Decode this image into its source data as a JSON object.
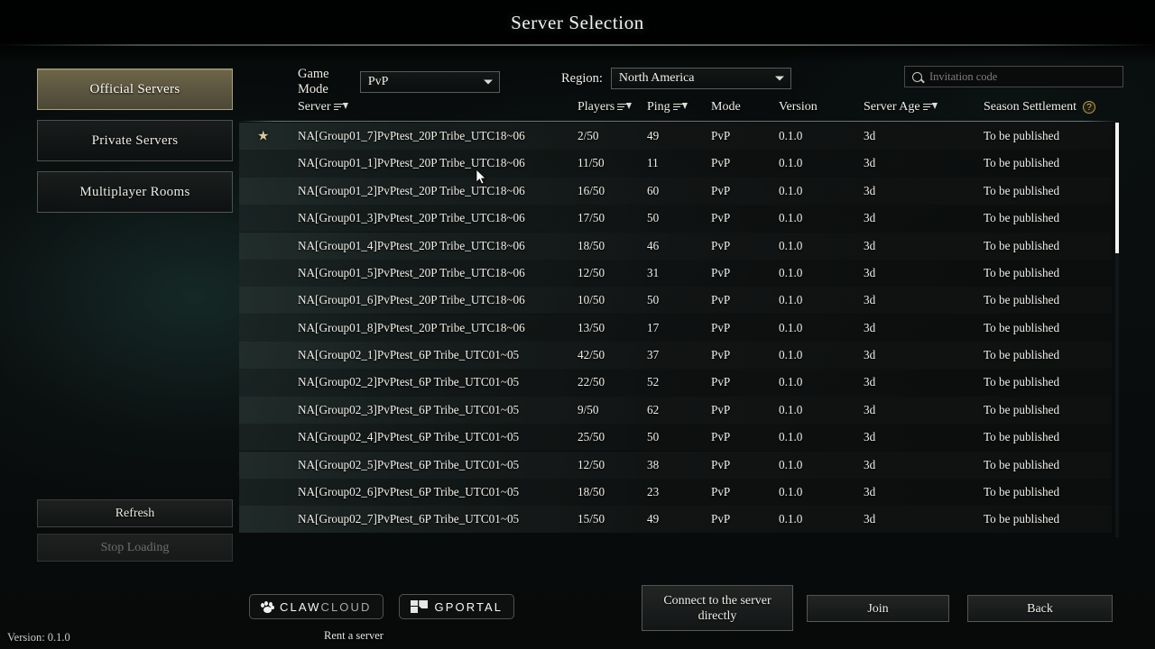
{
  "window": {
    "title": "Server Selection",
    "version_label": "Version: 0.1.0"
  },
  "sidebar": {
    "nav_items": [
      {
        "label": "Official Servers",
        "active": true
      },
      {
        "label": "Private Servers",
        "active": false
      },
      {
        "label": "Multiplayer Rooms",
        "active": false
      }
    ],
    "refresh_label": "Refresh",
    "stop_loading_label": "Stop Loading"
  },
  "filters": {
    "game_mode_label": "Game Mode",
    "game_mode_value": "PvP",
    "region_label": "Region:",
    "region_value": "North America"
  },
  "search": {
    "placeholder": "Invitation code",
    "value": ""
  },
  "table": {
    "columns": [
      {
        "key": "name",
        "label": "Server",
        "sortable": true
      },
      {
        "key": "players",
        "label": "Players",
        "sortable": true
      },
      {
        "key": "ping",
        "label": "Ping",
        "sortable": true
      },
      {
        "key": "mode",
        "label": "Mode",
        "sortable": false
      },
      {
        "key": "version",
        "label": "Version",
        "sortable": false
      },
      {
        "key": "age",
        "label": "Server Age",
        "sortable": true
      },
      {
        "key": "season",
        "label": "Season Settlement",
        "sortable": false,
        "help": true
      }
    ],
    "rows": [
      {
        "favorite": true,
        "name": "NA[Group01_7]PvPtest_20P Tribe_UTC18~06",
        "players": "2/50",
        "ping": "49",
        "mode": "PvP",
        "version": "0.1.0",
        "age": "3d",
        "season": "To be published"
      },
      {
        "favorite": false,
        "name": "NA[Group01_1]PvPtest_20P Tribe_UTC18~06",
        "players": "11/50",
        "ping": "11",
        "mode": "PvP",
        "version": "0.1.0",
        "age": "3d",
        "season": "To be published"
      },
      {
        "favorite": false,
        "name": "NA[Group01_2]PvPtest_20P Tribe_UTC18~06",
        "players": "16/50",
        "ping": "60",
        "mode": "PvP",
        "version": "0.1.0",
        "age": "3d",
        "season": "To be published"
      },
      {
        "favorite": false,
        "name": "NA[Group01_3]PvPtest_20P Tribe_UTC18~06",
        "players": "17/50",
        "ping": "50",
        "mode": "PvP",
        "version": "0.1.0",
        "age": "3d",
        "season": "To be published"
      },
      {
        "favorite": false,
        "name": "NA[Group01_4]PvPtest_20P Tribe_UTC18~06",
        "players": "18/50",
        "ping": "46",
        "mode": "PvP",
        "version": "0.1.0",
        "age": "3d",
        "season": "To be published"
      },
      {
        "favorite": false,
        "name": "NA[Group01_5]PvPtest_20P Tribe_UTC18~06",
        "players": "12/50",
        "ping": "31",
        "mode": "PvP",
        "version": "0.1.0",
        "age": "3d",
        "season": "To be published"
      },
      {
        "favorite": false,
        "name": "NA[Group01_6]PvPtest_20P Tribe_UTC18~06",
        "players": "10/50",
        "ping": "50",
        "mode": "PvP",
        "version": "0.1.0",
        "age": "3d",
        "season": "To be published"
      },
      {
        "favorite": false,
        "name": "NA[Group01_8]PvPtest_20P Tribe_UTC18~06",
        "players": "13/50",
        "ping": "17",
        "mode": "PvP",
        "version": "0.1.0",
        "age": "3d",
        "season": "To be published"
      },
      {
        "favorite": false,
        "name": "NA[Group02_1]PvPtest_6P Tribe_UTC01~05",
        "players": "42/50",
        "ping": "37",
        "mode": "PvP",
        "version": "0.1.0",
        "age": "3d",
        "season": "To be published"
      },
      {
        "favorite": false,
        "name": "NA[Group02_2]PvPtest_6P Tribe_UTC01~05",
        "players": "22/50",
        "ping": "52",
        "mode": "PvP",
        "version": "0.1.0",
        "age": "3d",
        "season": "To be published"
      },
      {
        "favorite": false,
        "name": "NA[Group02_3]PvPtest_6P Tribe_UTC01~05",
        "players": "9/50",
        "ping": "62",
        "mode": "PvP",
        "version": "0.1.0",
        "age": "3d",
        "season": "To be published"
      },
      {
        "favorite": false,
        "name": "NA[Group02_4]PvPtest_6P Tribe_UTC01~05",
        "players": "25/50",
        "ping": "50",
        "mode": "PvP",
        "version": "0.1.0",
        "age": "3d",
        "season": "To be published"
      },
      {
        "favorite": false,
        "name": "NA[Group02_5]PvPtest_6P Tribe_UTC01~05",
        "players": "12/50",
        "ping": "38",
        "mode": "PvP",
        "version": "0.1.0",
        "age": "3d",
        "season": "To be published"
      },
      {
        "favorite": false,
        "name": "NA[Group02_6]PvPtest_6P Tribe_UTC01~05",
        "players": "18/50",
        "ping": "23",
        "mode": "PvP",
        "version": "0.1.0",
        "age": "3d",
        "season": "To be published"
      },
      {
        "favorite": false,
        "name": "NA[Group02_7]PvPtest_6P Tribe_UTC01~05",
        "players": "15/50",
        "ping": "49",
        "mode": "PvP",
        "version": "0.1.0",
        "age": "3d",
        "season": "To be published"
      }
    ]
  },
  "sponsors": {
    "clawcloud_primary": "CLAW",
    "clawcloud_secondary": "CLOUD",
    "gportal_text": "GPORTAL",
    "rent_label": "Rent a server"
  },
  "actions": {
    "connect_direct": "Connect to the server directly",
    "join": "Join",
    "back": "Back"
  },
  "colors": {
    "accent_gold": "#6d6648",
    "help_gold": "#d6bc6b",
    "scrollbar": "#f4f4f2"
  }
}
